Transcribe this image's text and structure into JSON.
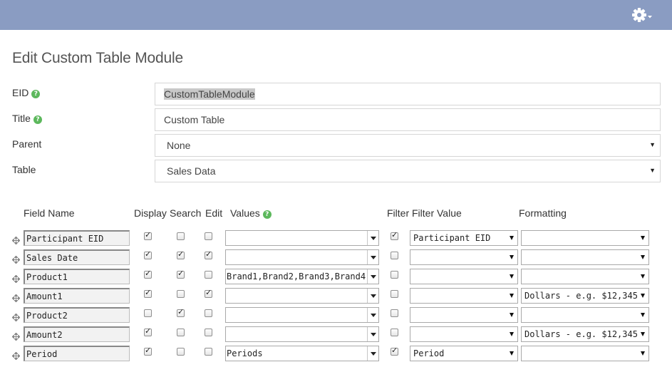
{
  "header": {
    "settings_icon": "gear-icon",
    "background": "#8a9cc2"
  },
  "page": {
    "title": "Edit Custom Table Module"
  },
  "form": {
    "eid": {
      "label": "EID",
      "value": "CustomTableModule"
    },
    "title": {
      "label": "Title",
      "value": "Custom Table"
    },
    "parent": {
      "label": "Parent",
      "value": "None"
    },
    "table": {
      "label": "Table",
      "value": "Sales Data"
    },
    "help_color": "#5cb85c"
  },
  "grid": {
    "headers": {
      "field_name": "Field Name",
      "display": "Display",
      "search": "Search",
      "edit": "Edit",
      "values": "Values",
      "filter": "Filter",
      "filter_value": "Filter Value",
      "formatting": "Formatting"
    },
    "rows": [
      {
        "field": "Participant EID",
        "display": true,
        "search": false,
        "edit": false,
        "values": "",
        "filter": true,
        "filter_value": "Participant EID",
        "formatting": ""
      },
      {
        "field": "Sales Date",
        "display": true,
        "search": true,
        "edit": true,
        "values": "",
        "filter": false,
        "filter_value": "",
        "formatting": ""
      },
      {
        "field": "Product1",
        "display": true,
        "search": true,
        "edit": false,
        "values": "Brand1,Brand2,Brand3,Brand4",
        "filter": false,
        "filter_value": "",
        "formatting": ""
      },
      {
        "field": "Amount1",
        "display": true,
        "search": false,
        "edit": true,
        "values": "",
        "filter": false,
        "filter_value": "",
        "formatting": "Dollars - e.g. $12,345"
      },
      {
        "field": "Product2",
        "display": false,
        "search": true,
        "edit": false,
        "values": "",
        "filter": false,
        "filter_value": "",
        "formatting": ""
      },
      {
        "field": "Amount2",
        "display": true,
        "search": false,
        "edit": false,
        "values": "",
        "filter": false,
        "filter_value": "",
        "formatting": "Dollars - e.g. $12,345"
      },
      {
        "field": "Period",
        "display": true,
        "search": false,
        "edit": false,
        "values": "Periods",
        "filter": true,
        "filter_value": "Period",
        "formatting": ""
      }
    ]
  }
}
